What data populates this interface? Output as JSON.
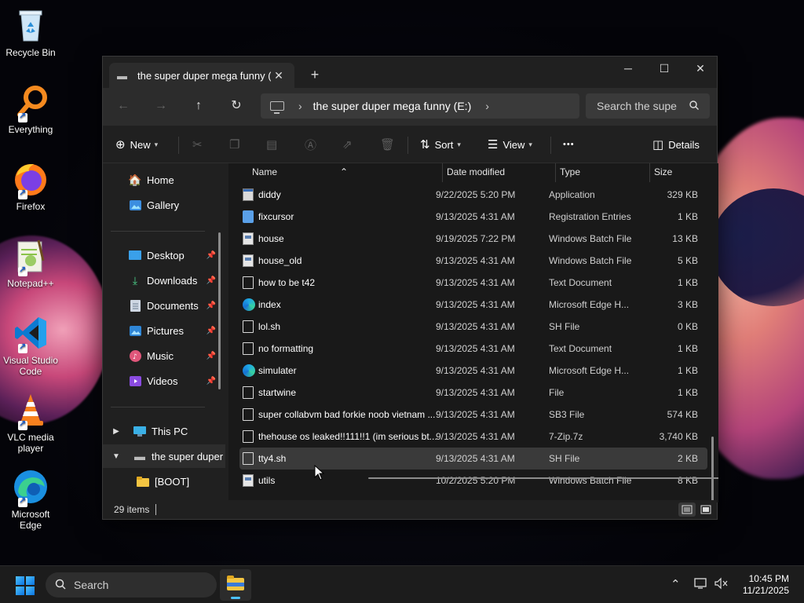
{
  "desktop": {
    "icons": [
      {
        "label": "Recycle Bin"
      },
      {
        "label": "Everything"
      },
      {
        "label": "Firefox"
      },
      {
        "label": "Notepad++"
      },
      {
        "label": "Visual Studio Code"
      },
      {
        "label": "VLC media player"
      },
      {
        "label": "Microsoft Edge"
      }
    ]
  },
  "window": {
    "tab_title": "the super duper mega funny (E:",
    "controls": {
      "minimize": "─",
      "maximize": "☐",
      "close": "✕"
    },
    "address": {
      "crumb": "the super duper mega funny (E:)"
    },
    "search_placeholder": "Search the supe",
    "toolbar": {
      "new_label": "New",
      "sort_label": "Sort",
      "view_label": "View",
      "more_label": "•••",
      "details_label": "Details"
    },
    "sidebar": {
      "home": "Home",
      "gallery": "Gallery",
      "desktop": "Desktop",
      "downloads": "Downloads",
      "documents": "Documents",
      "pictures": "Pictures",
      "music": "Music",
      "videos": "Videos",
      "this_pc": "This PC",
      "drive": "the super duper",
      "boot": "[BOOT]"
    },
    "columns": {
      "name": "Name",
      "date": "Date modified",
      "type": "Type",
      "size": "Size"
    },
    "files": [
      {
        "name": "diddy",
        "date": "9/22/2025 5:20 PM",
        "type": "Application",
        "size": "329 KB",
        "icon": "app"
      },
      {
        "name": "fixcursor",
        "date": "9/13/2025 4:31 AM",
        "type": "Registration Entries",
        "size": "1 KB",
        "icon": "reg"
      },
      {
        "name": "house",
        "date": "9/19/2025 7:22 PM",
        "type": "Windows Batch File",
        "size": "13 KB",
        "icon": "bat"
      },
      {
        "name": "house_old",
        "date": "9/13/2025 4:31 AM",
        "type": "Windows Batch File",
        "size": "5 KB",
        "icon": "bat"
      },
      {
        "name": "how to be t42",
        "date": "9/13/2025 4:31 AM",
        "type": "Text Document",
        "size": "1 KB",
        "icon": "blank"
      },
      {
        "name": "index",
        "date": "9/13/2025 4:31 AM",
        "type": "Microsoft Edge H...",
        "size": "3 KB",
        "icon": "edge"
      },
      {
        "name": "lol.sh",
        "date": "9/13/2025 4:31 AM",
        "type": "SH File",
        "size": "0 KB",
        "icon": "blank"
      },
      {
        "name": "no formatting",
        "date": "9/13/2025 4:31 AM",
        "type": "Text Document",
        "size": "1 KB",
        "icon": "blank"
      },
      {
        "name": "simulater",
        "date": "9/13/2025 4:31 AM",
        "type": "Microsoft Edge H...",
        "size": "1 KB",
        "icon": "edge"
      },
      {
        "name": "startwine",
        "date": "9/13/2025 4:31 AM",
        "type": "File",
        "size": "1 KB",
        "icon": "blank"
      },
      {
        "name": "super collabvm bad forkie noob vietnam ...",
        "date": "9/13/2025 4:31 AM",
        "type": "SB3 File",
        "size": "574 KB",
        "icon": "blank"
      },
      {
        "name": "thehouse os leaked!!111!!1 (im serious bt...",
        "date": "9/13/2025 4:31 AM",
        "type": "7-Zip.7z",
        "size": "3,740 KB",
        "icon": "blank"
      },
      {
        "name": "tty4.sh",
        "date": "9/13/2025 4:31 AM",
        "type": "SH File",
        "size": "2 KB",
        "icon": "blank",
        "selected": true
      },
      {
        "name": "utils",
        "date": "10/2/2025 5:20 PM",
        "type": "Windows Batch File",
        "size": "8 KB",
        "icon": "bat"
      }
    ],
    "status": {
      "item_count": "29 items"
    }
  },
  "taskbar": {
    "search_label": "Search",
    "time": "10:45 PM",
    "date": "11/21/2025"
  },
  "colors": {
    "accent": "#4cc2ff",
    "window_bg": "#202020",
    "list_bg": "#191919"
  }
}
